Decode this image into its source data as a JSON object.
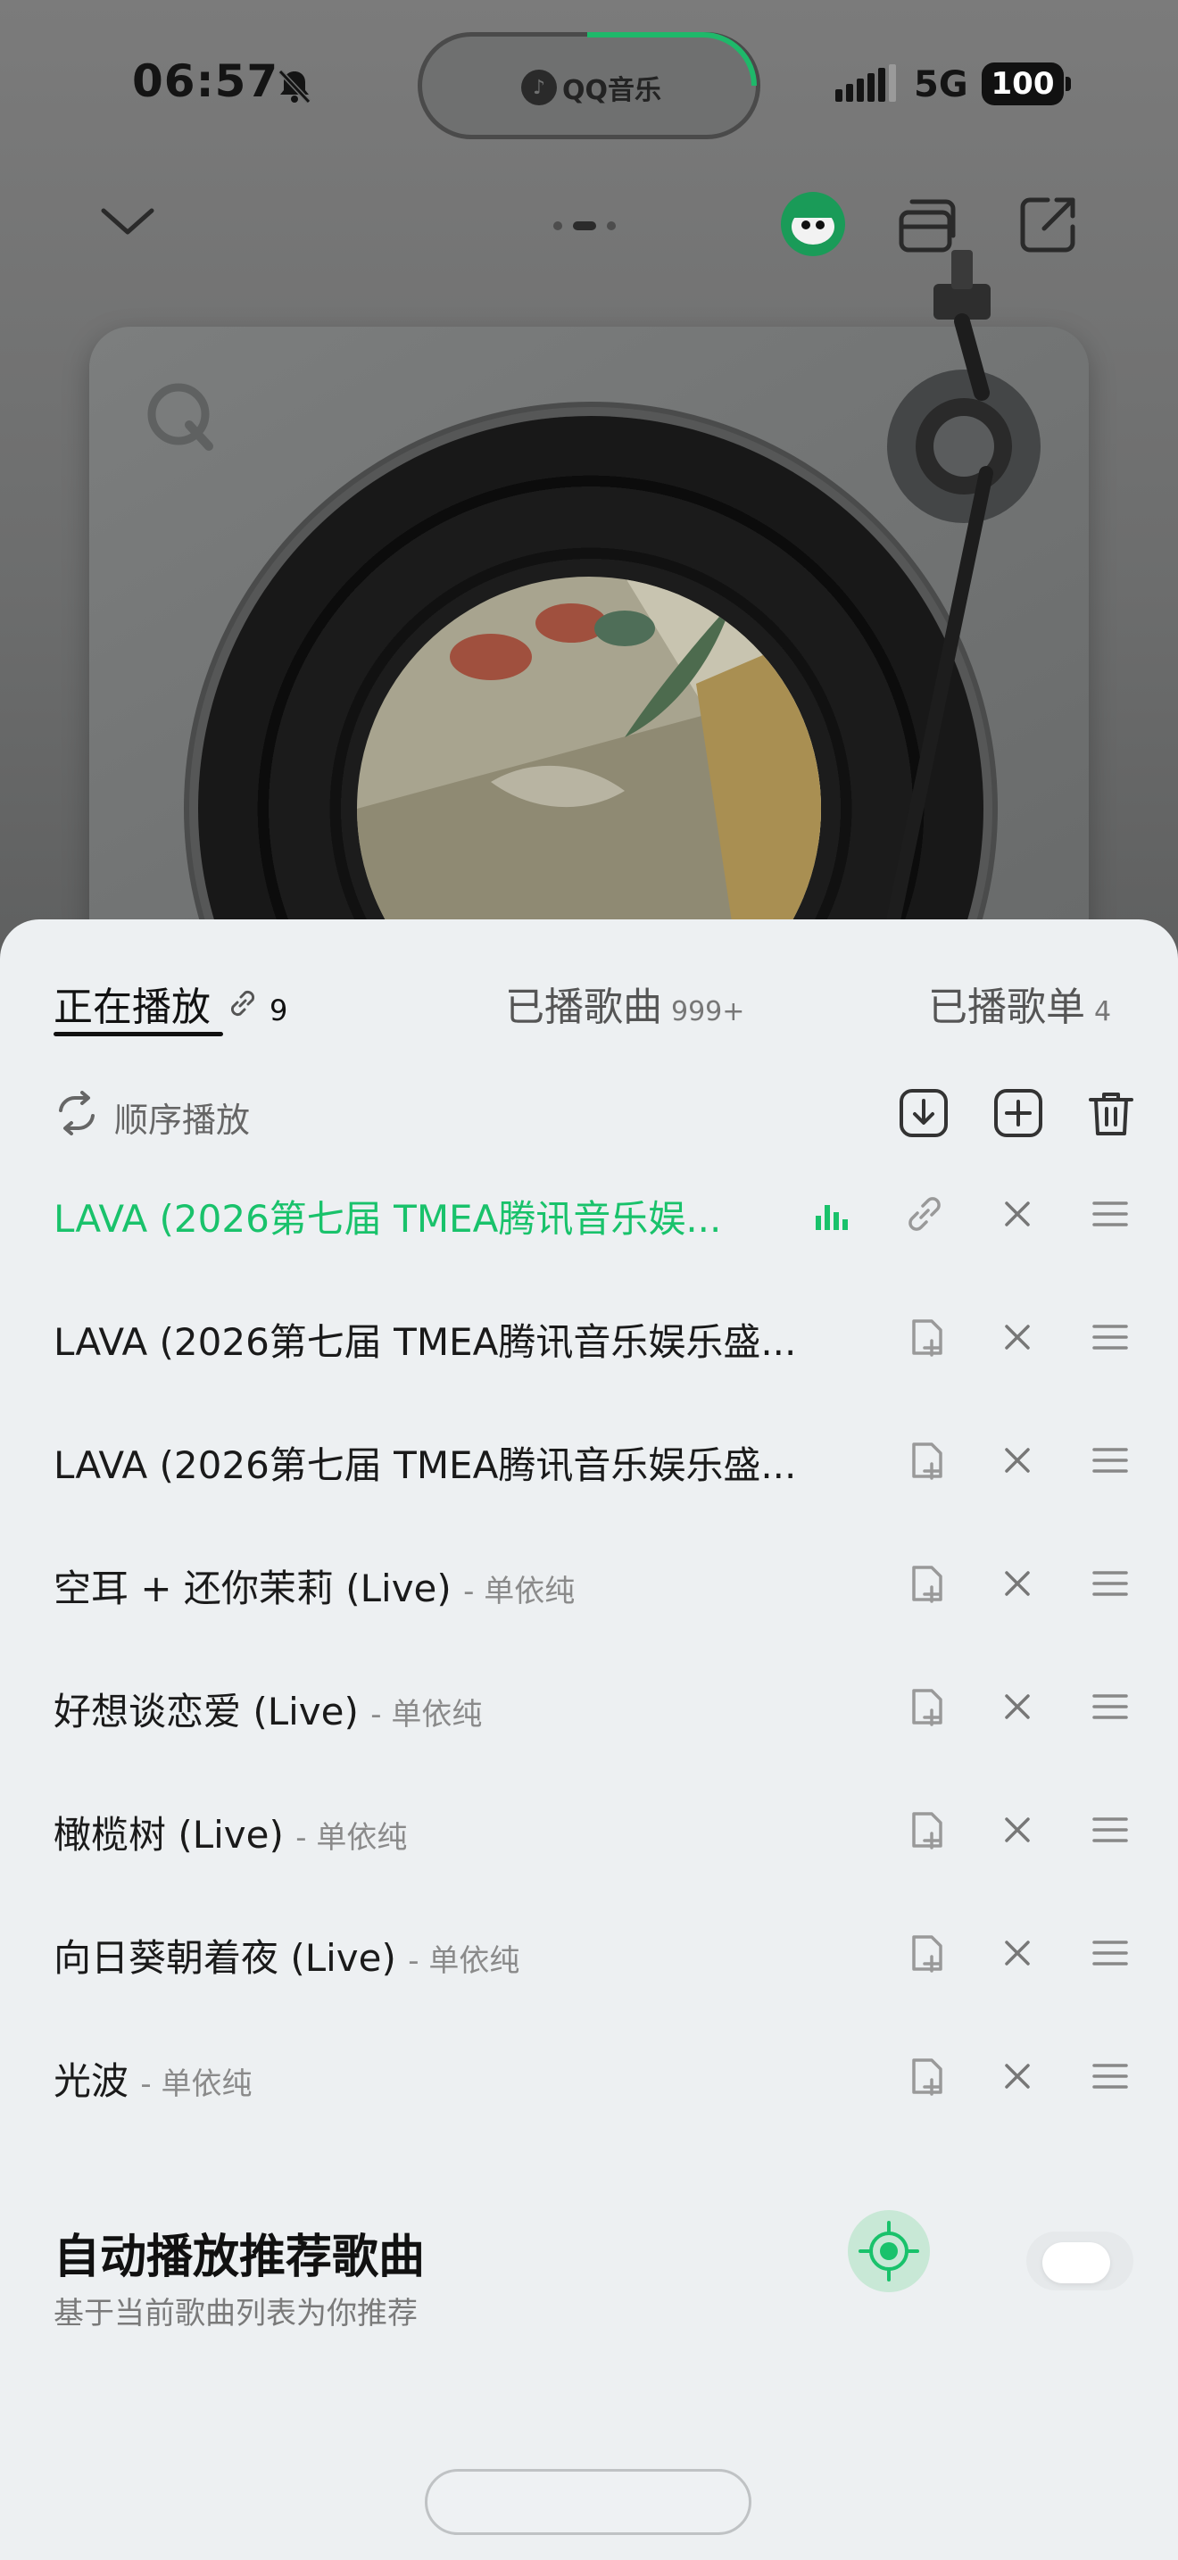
{
  "status_bar": {
    "time": "06:57",
    "island_label": "QQ音乐",
    "network": "5G",
    "battery": "100"
  },
  "tabs": {
    "now_playing": {
      "label": "正在播放",
      "count": "9"
    },
    "played_songs": {
      "label": "已播歌曲",
      "count": "999+"
    },
    "played_playlists": {
      "label": "已播歌单",
      "count": "4"
    }
  },
  "toolbar": {
    "play_mode": "顺序播放"
  },
  "queue": [
    {
      "title": "LAVA (2026第七届 TMEA腾讯音乐娱...",
      "artist": "",
      "current": true
    },
    {
      "title": "LAVA (2026第七届 TMEA腾讯音乐娱乐盛...",
      "artist": "",
      "current": false
    },
    {
      "title": "LAVA (2026第七届 TMEA腾讯音乐娱乐盛...",
      "artist": "",
      "current": false
    },
    {
      "title": "空耳 + 还你茉莉 (Live)",
      "artist": "- 单依纯",
      "current": false
    },
    {
      "title": "好想谈恋爱 (Live)",
      "artist": "- 单依纯",
      "current": false
    },
    {
      "title": "橄榄树 (Live)",
      "artist": "- 单依纯",
      "current": false
    },
    {
      "title": "向日葵朝着夜 (Live)",
      "artist": "- 单依纯",
      "current": false
    },
    {
      "title": "光波",
      "artist": "- 单依纯",
      "current": false
    }
  ],
  "autoplay": {
    "title": "自动播放推荐歌曲",
    "subtitle": "基于当前歌曲列表为你推荐",
    "enabled": false
  },
  "colors": {
    "accent": "#19c26b",
    "sheet_bg": "#edf0f2"
  }
}
